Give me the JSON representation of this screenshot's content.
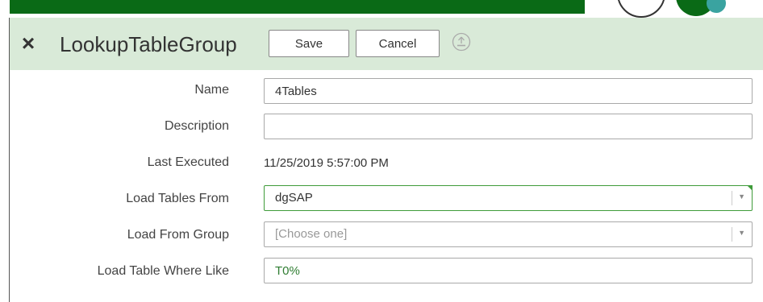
{
  "header": {
    "title": "LookupTableGroup",
    "save_label": "Save",
    "cancel_label": "Cancel",
    "close_icon": "×",
    "upload_icon": "upload-icon"
  },
  "form": {
    "name": {
      "label": "Name",
      "value": "4Tables"
    },
    "description": {
      "label": "Description",
      "value": ""
    },
    "last_executed": {
      "label": "Last Executed",
      "value": "11/25/2019 5:57:00 PM"
    },
    "load_tables_from": {
      "label": "Load Tables From",
      "value": "dgSAP"
    },
    "load_from_group": {
      "label": "Load From Group",
      "placeholder": "[Choose one]"
    },
    "load_table_where_like": {
      "label": "Load Table Where Like",
      "value": "T0%"
    }
  },
  "colors": {
    "brand_green": "#0a6a16",
    "header_bg": "#d9ead8",
    "focus_green": "#3f9b3a"
  }
}
